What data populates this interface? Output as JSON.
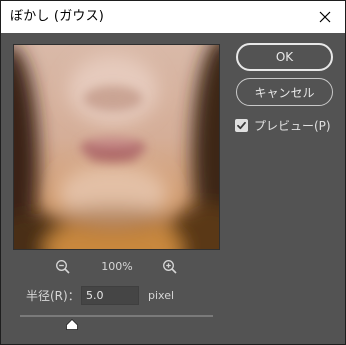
{
  "window": {
    "title": "ぼかし (ガウス)",
    "close_icon": "close-icon"
  },
  "preview": {
    "zoom_level": "100%",
    "zoom_out_icon": "zoom-out-icon",
    "zoom_in_icon": "zoom-in-icon"
  },
  "radius": {
    "label": "半径(R)：",
    "value": "5.0",
    "unit": "pixel",
    "slider_fraction": 0.27
  },
  "buttons": {
    "ok_label": "OK",
    "cancel_label": "キャンセル"
  },
  "preview_toggle": {
    "label": "プレビュー(P)",
    "checked": true
  },
  "colors": {
    "dialog_bg": "#535353",
    "title_bg": "#ffffff",
    "text": "#d6d6d6"
  }
}
